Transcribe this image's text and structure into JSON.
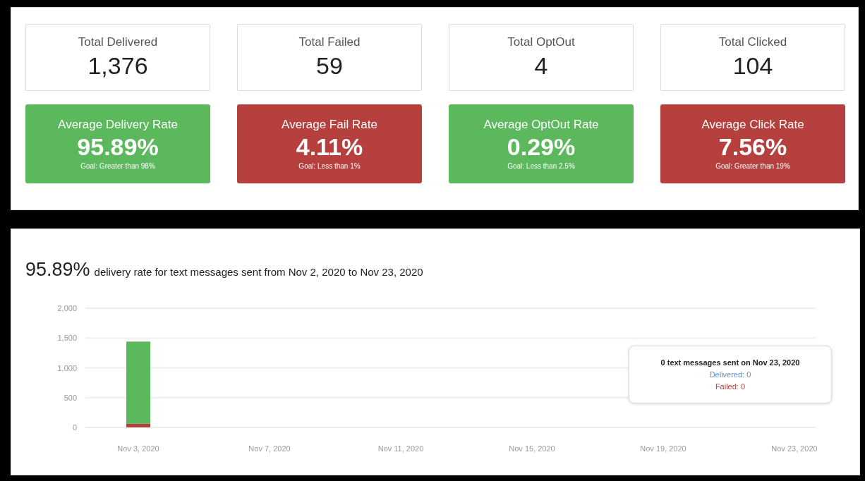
{
  "totals": [
    {
      "label": "Total Delivered",
      "value": "1,376"
    },
    {
      "label": "Total Failed",
      "value": "59"
    },
    {
      "label": "Total OptOut",
      "value": "4"
    },
    {
      "label": "Total Clicked",
      "value": "104"
    }
  ],
  "rates": [
    {
      "label": "Average Delivery Rate",
      "value": "95.89%",
      "goal": "Goal: Greater than 98%",
      "color": "#5cb85c"
    },
    {
      "label": "Average Fail Rate",
      "value": "4.11%",
      "goal": "Goal: Less than 1%",
      "color": "#b5403d"
    },
    {
      "label": "Average OptOut Rate",
      "value": "0.29%",
      "goal": "Goal: Less than 2.5%",
      "color": "#5cb85c"
    },
    {
      "label": "Average Click Rate",
      "value": "7.56%",
      "goal": "Goal: Greater than 19%",
      "color": "#b5403d"
    }
  ],
  "delivery_panel": {
    "headline_value": "95.89%",
    "headline_text": "delivery rate for text messages sent from Nov 2, 2020 to Nov 23, 2020",
    "chart_data": {
      "type": "bar",
      "stacked": true,
      "categories": [
        "Nov 3, 2020",
        "Nov 7, 2020",
        "Nov 11, 2020",
        "Nov 15, 2020",
        "Nov 19, 2020",
        "Nov 23, 2020"
      ],
      "series": [
        {
          "color": "#b5403d",
          "values": [
            60,
            0,
            0,
            0,
            0,
            0
          ]
        },
        {
          "color": "#5cb85c",
          "values": [
            1380,
            0,
            0,
            0,
            0,
            0
          ]
        }
      ],
      "grid": true,
      "ylim": [
        0,
        2000
      ],
      "yticks": [
        {
          "value": 0,
          "label": "0"
        },
        {
          "value": 500,
          "label": "500"
        },
        {
          "value": 1000,
          "label": "1,000"
        },
        {
          "value": 1500,
          "label": "1,500"
        },
        {
          "value": 2000,
          "label": "2,000"
        }
      ]
    },
    "tooltip": {
      "title": "0 text messages sent on Nov 23, 2020",
      "lines": [
        {
          "text": "Delivered: 0",
          "color": "#5b8fd6"
        },
        {
          "text": "Failed: 0",
          "color": "#b5403d"
        }
      ]
    }
  }
}
